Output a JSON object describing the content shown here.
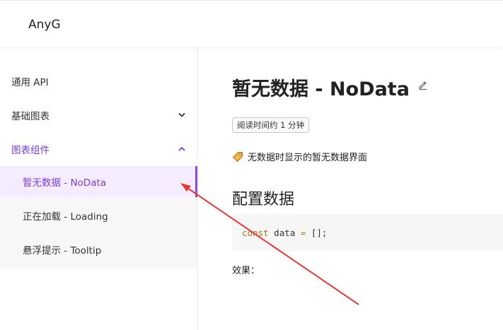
{
  "header": {
    "brand": "AnyG"
  },
  "sidebar": {
    "items": [
      {
        "label": "通用 API"
      },
      {
        "label": "基础图表",
        "expanded": false
      },
      {
        "label": "图表组件",
        "expanded": true
      }
    ],
    "sub_items": [
      {
        "label": "暂无数据 - NoData",
        "active": true
      },
      {
        "label": "正在加载 - Loading",
        "active": false
      },
      {
        "label": "悬浮提示 - Tooltip",
        "active": false
      }
    ]
  },
  "main": {
    "title": "暂无数据 - NoData",
    "read_time": "阅读时间约 1 分钟",
    "description": "无数据时显示的暂无数据界面",
    "section_title": "配置数据",
    "code": {
      "keyword": "const",
      "identifier": "data",
      "operator": "=",
      "value": "[];"
    },
    "effect_label": "效果："
  },
  "colors": {
    "accent": "#7a3fd6",
    "active_bg": "#f5ecff",
    "arrow": "#e53935"
  },
  "icons": {
    "edit": "edit-icon",
    "tag": "tag-icon",
    "chevron_down": "chevron-down-icon",
    "chevron_up": "chevron-up-icon"
  }
}
